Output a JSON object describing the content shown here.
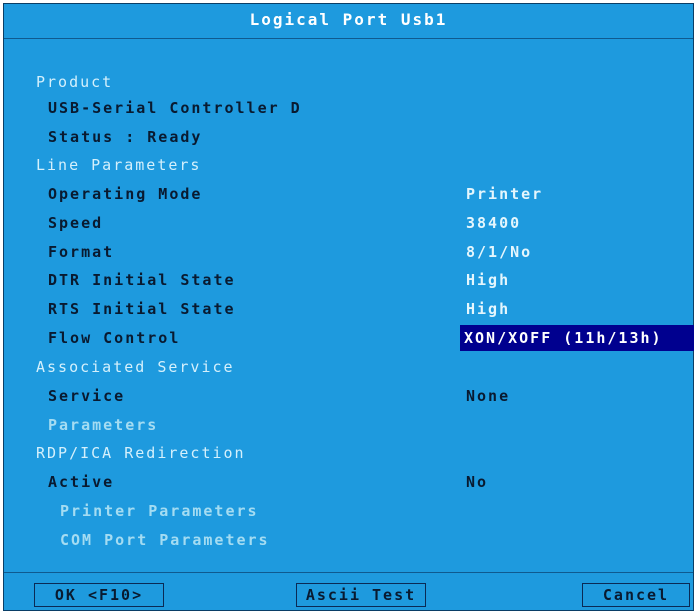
{
  "window": {
    "title": "Logical Port Usb1"
  },
  "product": {
    "header": "Product",
    "name": "USB-Serial Controller D",
    "status": "Status : Ready"
  },
  "line_parameters": {
    "header": "Line Parameters",
    "rows": [
      {
        "label": "Operating Mode",
        "value": "Printer"
      },
      {
        "label": "Speed",
        "value": "38400"
      },
      {
        "label": "Format",
        "value": "8/1/No"
      },
      {
        "label": "DTR Initial State",
        "value": "High"
      },
      {
        "label": "RTS Initial State",
        "value": "High"
      },
      {
        "label": "Flow Control",
        "value": "XON/XOFF (11h/13h)",
        "selected": true
      }
    ]
  },
  "associated_service": {
    "header": "Associated Service",
    "service_label": "Service",
    "service_value": "None",
    "parameters_label": "Parameters"
  },
  "redirection": {
    "header": "RDP/ICA Redirection",
    "active_label": "Active",
    "active_value": "No",
    "printer_parameters": "Printer Parameters",
    "com_port_parameters": "COM Port Parameters"
  },
  "buttons": {
    "ok": "OK <F10>",
    "ascii_test": "Ascii Test",
    "cancel": "Cancel"
  },
  "colors": {
    "background": "#1e9ade",
    "selection": "#00008f",
    "text_dark": "#091a30",
    "text_light": "#e4f6fd"
  }
}
